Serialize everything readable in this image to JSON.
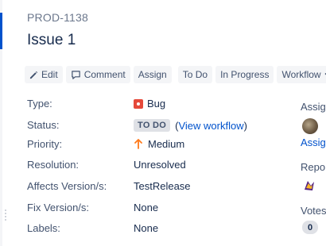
{
  "issue": {
    "key": "PROD-1138",
    "title": "Issue 1"
  },
  "toolbar": {
    "edit_label": "Edit",
    "comment_label": "Comment",
    "assign_label": "Assign",
    "todo_label": "To Do",
    "in_progress_label": "In Progress",
    "workflow_label": "Workflow"
  },
  "details": {
    "type": {
      "label": "Type:",
      "value": "Bug",
      "icon": "bug-icon",
      "icon_color": "#e5493a"
    },
    "status": {
      "label": "Status:",
      "value": "TO DO",
      "link_open": "(",
      "link_text": "View workflow",
      "link_close": ")"
    },
    "priority": {
      "label": "Priority:",
      "value": "Medium",
      "icon": "priority-up-arrow-icon",
      "icon_color": "#ff7a1a"
    },
    "resolution": {
      "label": "Resolution:",
      "value": "Unresolved"
    },
    "affects_versions": {
      "label": "Affects Version/s:",
      "value": "TestRelease"
    },
    "fix_versions": {
      "label": "Fix Version/s:",
      "value": "None"
    },
    "labels": {
      "label": "Labels:",
      "value": "None"
    }
  },
  "people": {
    "assignee_label": "Assig",
    "assign_link": "Assig",
    "reporter_label": "Repor",
    "votes_label": "Votes",
    "votes_count": "0"
  },
  "colors": {
    "link": "#0052cc",
    "text": "#172b4d",
    "label": "#42526e",
    "button_bg": "#f4f5f7"
  }
}
